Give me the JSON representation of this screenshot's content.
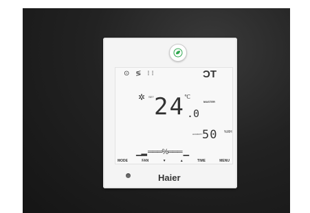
{
  "colors": {
    "panel": "#1e1e1e",
    "controller": "#f4f4f4",
    "eco_leaf": "#2fa84f"
  },
  "eco_button": {
    "icon": "leaf-icon"
  },
  "lcd": {
    "status_icons": "⊙ ≶ ⁝⁝",
    "master_icons": "ϽT",
    "sun_icon": "✲",
    "set_label": "SET",
    "temperature": "24",
    "temperature_unit": "℃",
    "temperature_decimal": ".0",
    "master_label": "MASTER",
    "humidity_label": "HUMIDITY",
    "humidity": "50",
    "humidity_unit": "%RH",
    "fan_bar": "▁▂ ═══",
    "fan_auto": "%",
    "fan_bar_right": "═══ ▁"
  },
  "buttons": {
    "mode": "MODE",
    "fan": "FAN",
    "down": "▼",
    "up": "▲",
    "time": "TIME",
    "menu": "MENU"
  },
  "brand": "Haier"
}
